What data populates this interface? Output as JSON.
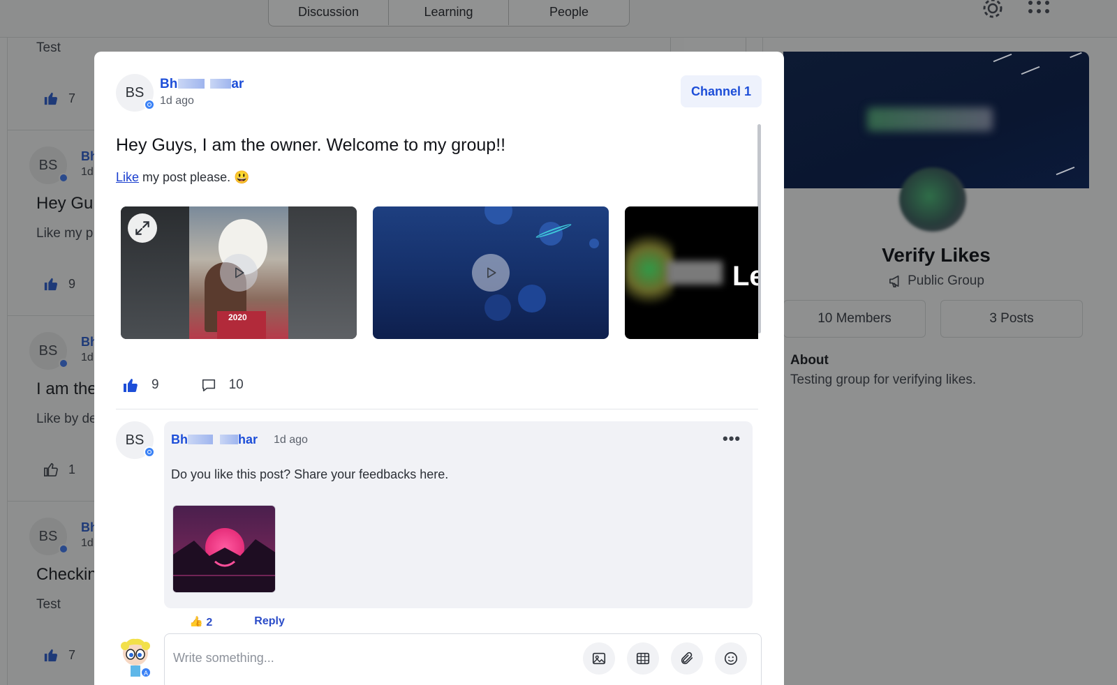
{
  "nav": {
    "tabs": [
      "Discussion",
      "Learning",
      "People"
    ],
    "settings_icon": "gear-icon",
    "apps_icon": "grid-icon"
  },
  "background_feed": {
    "top_text": "Test",
    "top_likes": "7",
    "posts": [
      {
        "initials": "BS",
        "name": "Bh",
        "time": "1d",
        "title": "Hey Gu",
        "sub": "Like my p",
        "likes": "9"
      },
      {
        "initials": "BS",
        "name": "Bh",
        "time": "1d",
        "title": "I am the",
        "sub": "Like by de",
        "likes": "1"
      },
      {
        "initials": "BS",
        "name": "Bh",
        "time": "1d",
        "title": "Checkin",
        "sub": "Test",
        "likes": "7"
      }
    ]
  },
  "group": {
    "name": "Verify Likes",
    "type": "Public Group",
    "members": "10 Members",
    "posts": "3 Posts",
    "about_heading": "About",
    "about_text": "Testing group for verifying likes."
  },
  "modal": {
    "author": {
      "initials": "BS",
      "name_start": "Bh",
      "name_end": "ar",
      "time": "1d ago"
    },
    "channel": "Channel 1",
    "title": "Hey Guys, I am the owner. Welcome to my group!!",
    "body_link": "Like",
    "body_rest": " my post please. 😃",
    "media": [
      {
        "type": "video",
        "caption": "2020"
      },
      {
        "type": "video",
        "caption": ""
      },
      {
        "type": "image",
        "caption": "Le"
      }
    ],
    "like_count": "9",
    "comment_count": "10",
    "comment": {
      "initials": "BS",
      "name_start": "Bh",
      "name_end": "har",
      "time": "1d ago",
      "text": "Do you like this post? Share your feedbacks here.",
      "more": "•••",
      "like_count": "2",
      "reply_label": "Reply"
    },
    "composer": {
      "placeholder": "Write something...",
      "tools": [
        "image-icon",
        "video-icon",
        "attachment-icon",
        "emoji-icon"
      ]
    }
  },
  "colors": {
    "accent": "#1d4ed8",
    "overlay": "#8f9090",
    "modal_bg": "#ffffff"
  }
}
